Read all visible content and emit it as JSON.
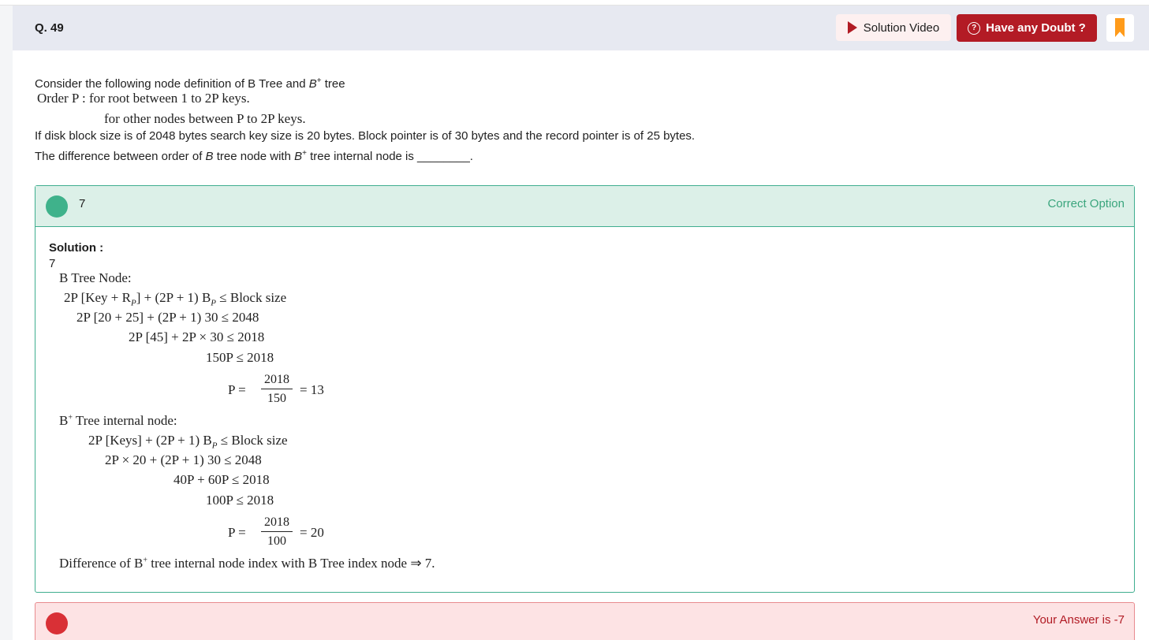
{
  "question": {
    "number": "Q. 49",
    "intro_a": "Consider the following node definition of B Tree and ",
    "intro_b": "B",
    "intro_sup": "+",
    "intro_c": " tree",
    "order_line1": "Order P : for root between 1 to 2P keys.",
    "order_line2": "for other nodes between P to 2P keys.",
    "disk_line": "If disk block size is of 2048 bytes search key size is 20 bytes. Block pointer is of 30 bytes and the record pointer is of 25 bytes.",
    "diff_a": "The difference between order of ",
    "diff_b": "B",
    "diff_c": " tree node with ",
    "diff_d": "B",
    "diff_sup": "+",
    "diff_e": " tree internal node is ________."
  },
  "header": {
    "solution_video_label": "Solution Video",
    "doubt_label": "Have any Doubt ?",
    "doubt_icon": "?"
  },
  "correct_option": {
    "value": "7",
    "label": "Correct Option"
  },
  "solution": {
    "title": "Solution :",
    "answer": "7",
    "btree_title": "B Tree Node:",
    "btree_l1": "2P [Key + R",
    "btree_l1_sub": "P",
    "btree_l1_b": "] + (2P + 1) B",
    "btree_l1_sub2": "P",
    "btree_l1_c": " ≤ Block size",
    "btree_l2": "2P [20 + 25] + (2P + 1) 30 ≤ 2048",
    "btree_l3": "2P [45] + 2P × 30 ≤ 2018",
    "btree_l4": "150P ≤ 2018",
    "btree_p": "P =",
    "btree_num": "2018",
    "btree_den": "150",
    "btree_res": "= 13",
    "bplus_title_a": "B",
    "bplus_title_sup": "+",
    "bplus_title_b": " Tree internal node:",
    "bplus_l1": "2P [Keys] + (2P + 1) B",
    "bplus_l1_sub": "P",
    "bplus_l1_c": " ≤ Block size",
    "bplus_l2": "2P × 20 + (2P + 1) 30 ≤ 2048",
    "bplus_l3": "40P + 60P ≤ 2018",
    "bplus_l4": "100P ≤ 2018",
    "bplus_p": "P =",
    "bplus_num": "2018",
    "bplus_den": "100",
    "bplus_res": "= 20",
    "diff_a": "Difference of B",
    "diff_sup": "+",
    "diff_b": " tree internal node index with B Tree index node ⇒ 7."
  },
  "your_answer": {
    "label": "Your Answer is -7"
  },
  "colors": {
    "accent_red": "#b31b25",
    "correct_green": "#3fb28b",
    "bookmark_orange": "#ff9b1a",
    "wrong_red": "#d93036"
  }
}
